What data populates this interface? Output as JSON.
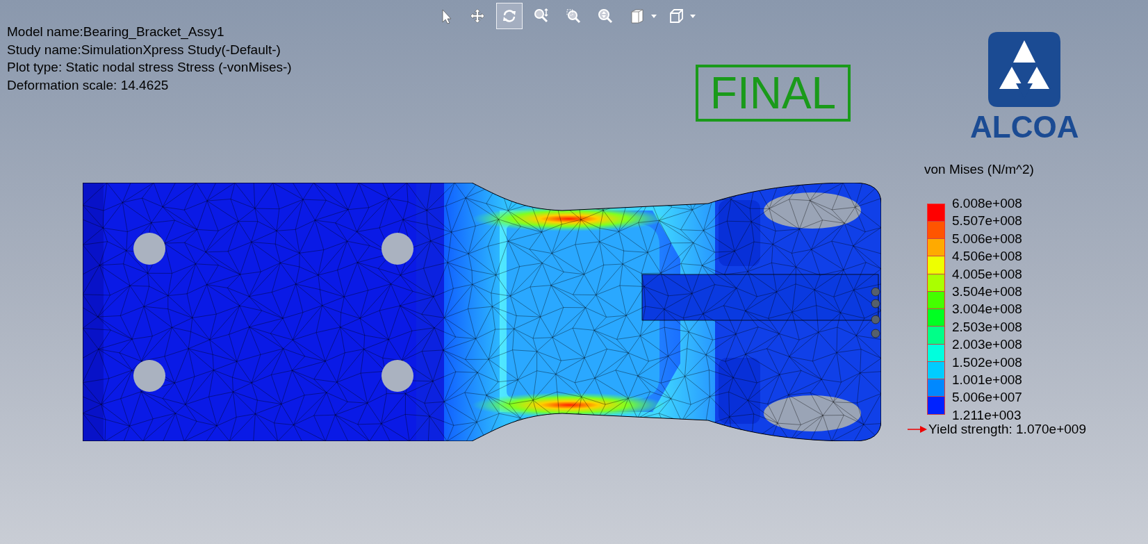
{
  "toolbar": [
    {
      "kind": "select",
      "selected": false,
      "has_menu": false
    },
    {
      "kind": "pan",
      "selected": false,
      "has_menu": false
    },
    {
      "kind": "rotate",
      "selected": true,
      "has_menu": false
    },
    {
      "kind": "zoom-fit",
      "selected": false,
      "has_menu": false
    },
    {
      "kind": "zoom-area",
      "selected": false,
      "has_menu": false
    },
    {
      "kind": "zoom-in",
      "selected": false,
      "has_menu": false
    },
    {
      "kind": "view-orientation",
      "selected": false,
      "has_menu": true
    },
    {
      "kind": "display-style",
      "selected": false,
      "has_menu": true
    }
  ],
  "info_lines": [
    "Model name:Bearing_Bracket_Assy1",
    "Study name:SimulationXpress Study(-Default-)",
    "Plot type: Static nodal stress Stress (-vonMises-)",
    "Deformation scale: 14.4625"
  ],
  "stamp": "FINAL",
  "logo": {
    "text": "ALCOA"
  },
  "legend": {
    "title": "von Mises (N/m^2)",
    "ticks": [
      "6.008e+008",
      "5.507e+008",
      "5.006e+008",
      "4.506e+008",
      "4.005e+008",
      "3.504e+008",
      "3.004e+008",
      "2.503e+008",
      "2.003e+008",
      "1.502e+008",
      "1.001e+008",
      "5.006e+007",
      "1.211e+003"
    ],
    "bands": [
      {
        "color": "#ff0000"
      },
      {
        "color": "#ff5500"
      },
      {
        "color": "#ffaa00"
      },
      {
        "color": "#eeff00"
      },
      {
        "color": "#aaff00"
      },
      {
        "color": "#44ff00"
      },
      {
        "color": "#00ff22"
      },
      {
        "color": "#00ff88"
      },
      {
        "color": "#00ffdd"
      },
      {
        "color": "#00ccff"
      },
      {
        "color": "#0088ff"
      },
      {
        "color": "#0022ff"
      }
    ],
    "yield": "Yield strength: 1.070e+009"
  }
}
